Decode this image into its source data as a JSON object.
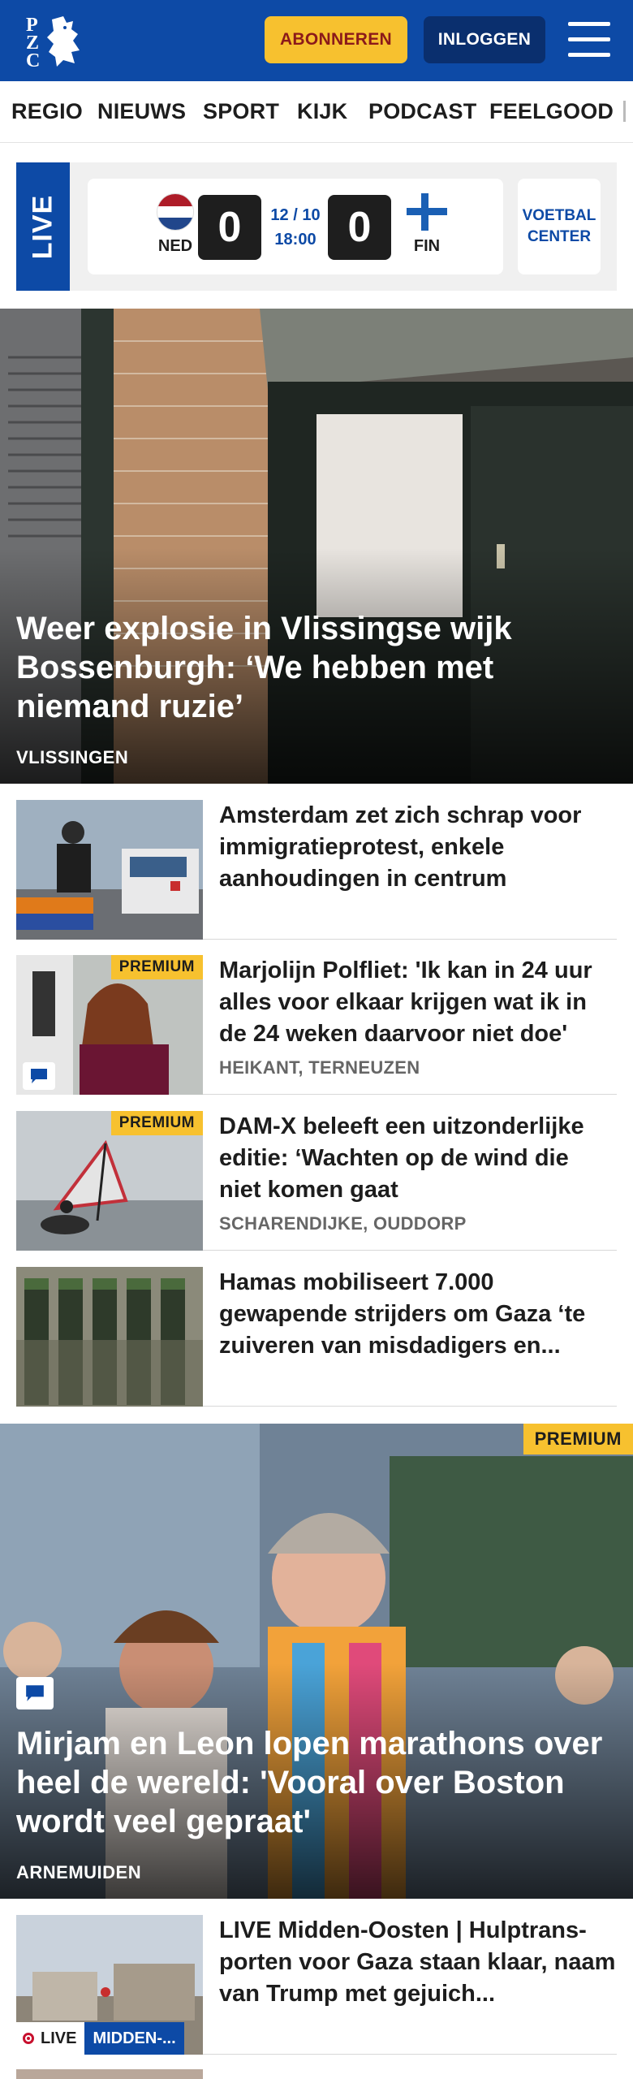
{
  "header": {
    "logo_text": "PZC",
    "subscribe_label": "ABONNEREN",
    "login_label": "INLOGGEN"
  },
  "nav": {
    "items": [
      {
        "label": "REGIO"
      },
      {
        "label": "NIEUWS"
      },
      {
        "label": "SPORT"
      },
      {
        "label": "KIJK"
      },
      {
        "label": "PODCAST"
      },
      {
        "label": "FEELGOOD"
      }
    ]
  },
  "live_widget": {
    "tag": "LIVE",
    "home_team": "NED",
    "away_team": "FIN",
    "home_score": "0",
    "away_score": "0",
    "date": "12 / 10",
    "time": "18:00",
    "voetbal_center_line1": "VOETBAL",
    "voetbal_center_line2": "CENTER",
    "colors": {
      "ned_red": "#ae1c28",
      "ned_white": "#ffffff",
      "ned_blue": "#21468b",
      "fin_blue": "#1a5fb4"
    }
  },
  "hero": {
    "title": "Weer explosie in Vlissingse wijk Bossenburgh: ‘We hebben met niemand ruzie’",
    "location": "VLISSINGEN"
  },
  "articles": [
    {
      "title": "Amsterdam zet zich schrap voor immigratieprotest, enkele aanhoudingen in centrum",
      "location": "",
      "premium": ""
    },
    {
      "title": "Marjolijn Polfliet: 'Ik kan in 24 uur alles voor elkaar krijgen wat ik in de 24 weken daarvoor niet doe'",
      "location": "HEIKANT, TERNEUZEN",
      "premium": "PREMIUM"
    },
    {
      "title": "DAM-X beleeft een uitzonderlijke editie: ‘Wachten op de wind die niet komen gaat",
      "location": "SCHARENDIJKE, OUDDORP",
      "premium": "PREMIUM"
    },
    {
      "title": "Hamas mobiliseert 7.000 gewapende strijders om Gaza ‘te zuiveren van misdadigers en...",
      "location": "",
      "premium": ""
    }
  ],
  "feature": {
    "premium": "PREMIUM",
    "title": "Mirjam en Leon lopen marathons over heel de wereld: 'Vooral over Boston wordt veel gepraat'",
    "location": "ARNEMUIDEN"
  },
  "live_article": {
    "title": "LIVE Midden-Oosten | Hulptrans-porten voor Gaza staan klaar, naam van Trump met gejuich...",
    "live_label": "LIVE",
    "tag_label": "MIDDEN-..."
  },
  "accent_colors": {
    "brand_blue": "#0d4aa6",
    "premium_yellow": "#f7c12f"
  }
}
